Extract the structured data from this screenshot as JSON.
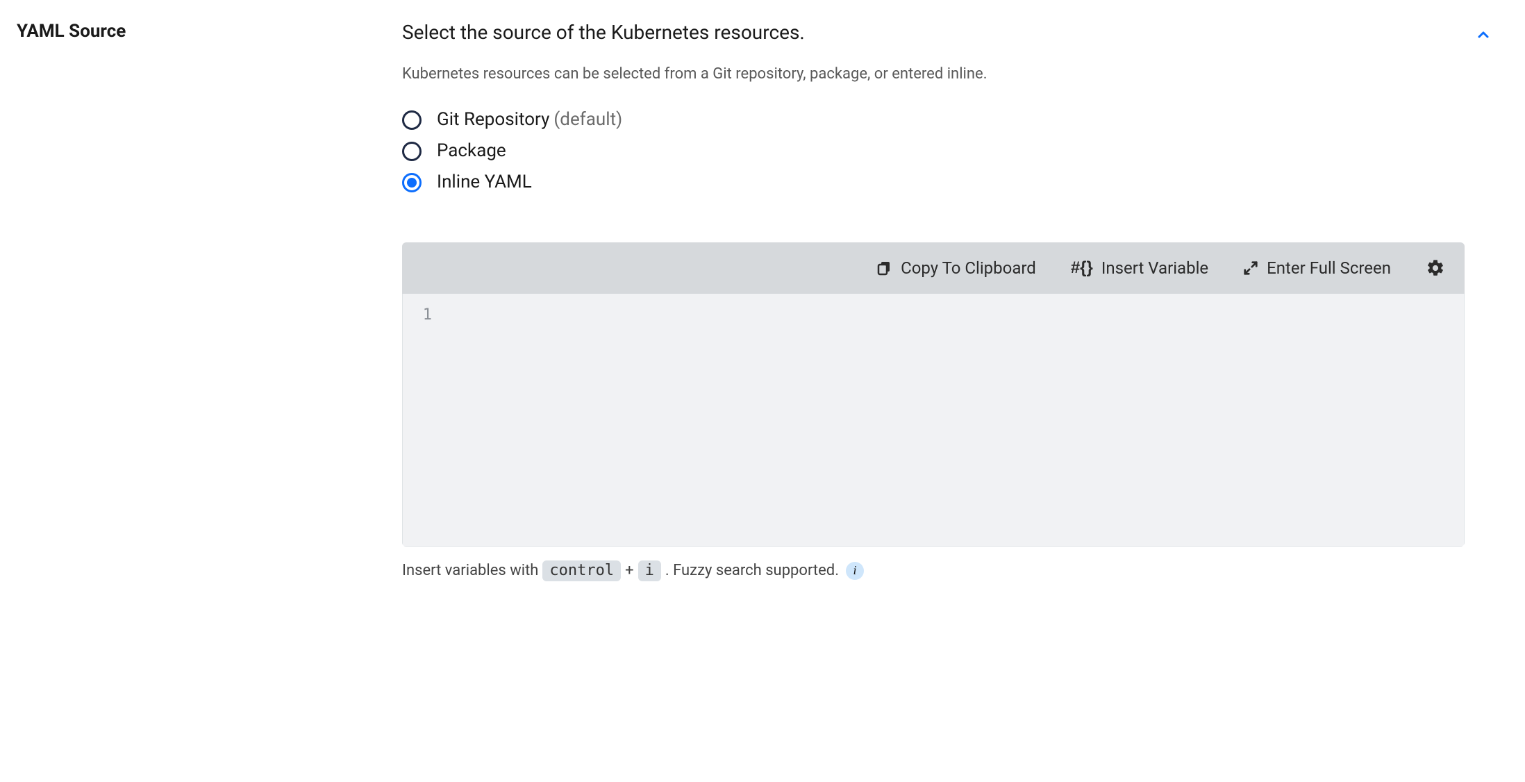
{
  "section": {
    "label": "YAML Source",
    "title": "Select the source of the Kubernetes resources.",
    "help": "Kubernetes resources can be selected from a Git repository, package, or entered inline."
  },
  "options": [
    {
      "label": "Git Repository",
      "hint": "(default)",
      "selected": false
    },
    {
      "label": "Package",
      "hint": "",
      "selected": false
    },
    {
      "label": "Inline YAML",
      "hint": "",
      "selected": true
    }
  ],
  "toolbar": {
    "copy": "Copy To Clipboard",
    "insert_var": "Insert Variable",
    "fullscreen": "Enter Full Screen"
  },
  "editor": {
    "line_number": "1",
    "content": ""
  },
  "footer": {
    "prefix": "Insert variables with",
    "key1": "control",
    "plus": "+",
    "key2": "i",
    "suffix": ".  Fuzzy search supported.",
    "info_glyph": "i"
  }
}
